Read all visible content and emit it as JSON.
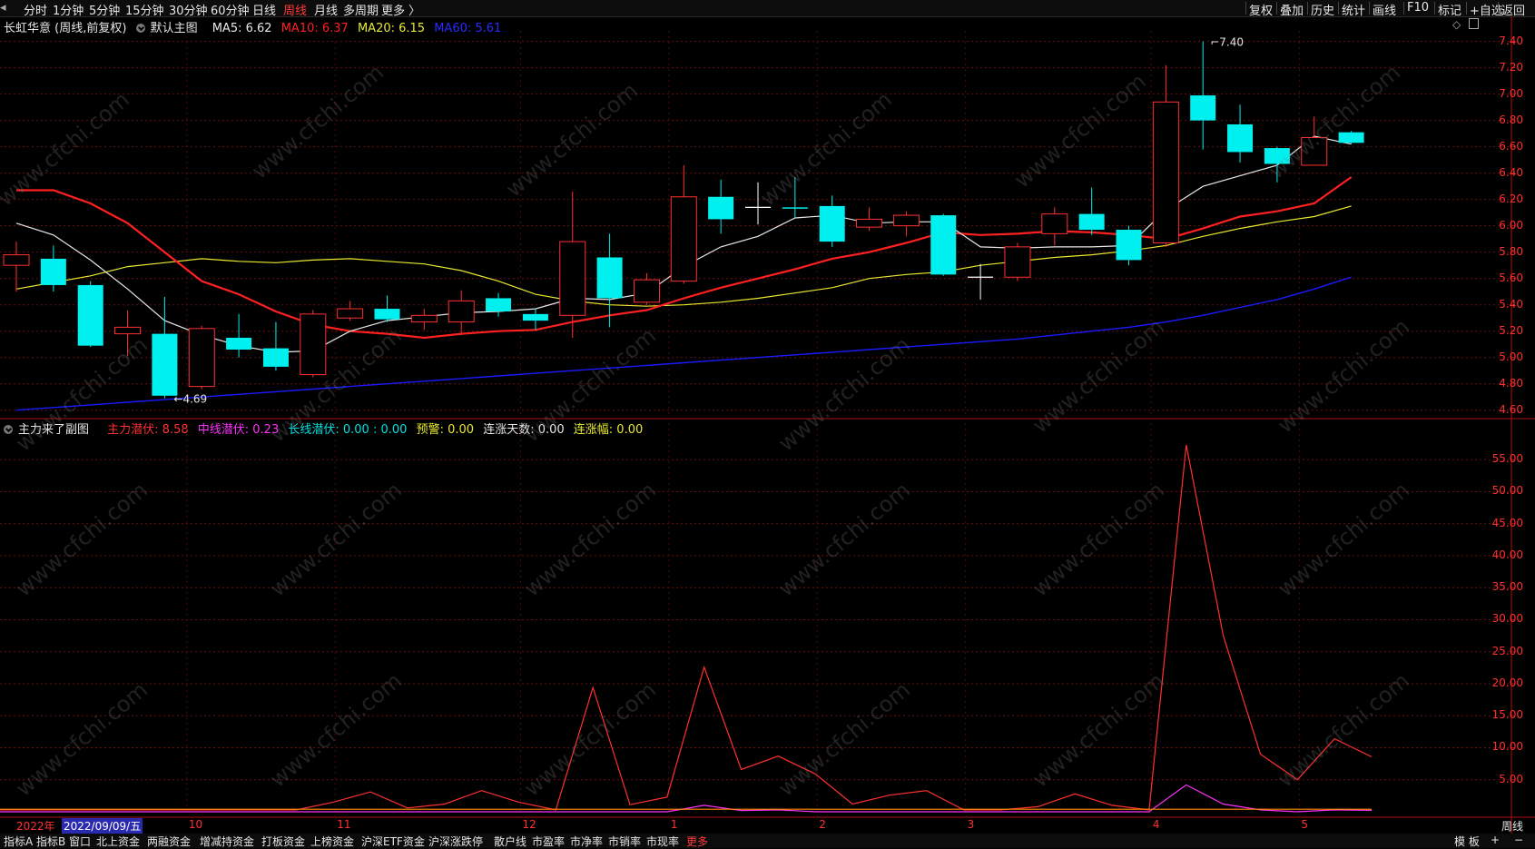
{
  "topbar": {
    "periods": [
      "分时",
      "1分钟",
      "5分钟",
      "15分钟",
      "30分钟",
      "60分钟",
      "日线",
      "周线",
      "月线",
      "多周期",
      "更多 〉"
    ],
    "active_index": 7,
    "right_tools": [
      "复权",
      "叠加",
      "历史",
      "统计",
      "画线",
      "F10",
      "标记",
      "+自选",
      "返回"
    ]
  },
  "main_legend": {
    "title": "长虹华意 (周线,前复权)",
    "indicator": "默认主图",
    "ma5": "MA5: 6.62",
    "ma10": "MA10: 6.37",
    "ma20": "MA20: 6.15",
    "ma60": "MA60: 5.61"
  },
  "sub_legend": {
    "title": "主力来了副图",
    "a": "主力潜伏: 8.58",
    "b": "中线潜伏: 0.23",
    "c": "长线潜伏: 0.00 : 0.00",
    "d": "预警: 0.00",
    "e": "连涨天数: 0.00",
    "f": "连涨幅: 0.00"
  },
  "colors": {
    "up": "#ff3030",
    "down": "#00f0f0",
    "ma5": "#e8e8e8",
    "ma10": "#ff2020",
    "ma20": "#e8e830",
    "ma60": "#1a1aff",
    "magenta": "#ff30ff"
  },
  "main_axis": [
    "7.40",
    "7.20",
    "7.00",
    "6.80",
    "6.60",
    "6.40",
    "6.20",
    "6.00",
    "5.80",
    "5.60",
    "5.40",
    "5.20",
    "5.00",
    "4.80",
    "4.60"
  ],
  "sub_axis": [
    "55.00",
    "50.00",
    "45.00",
    "40.00",
    "35.00",
    "30.00",
    "25.00",
    "20.00",
    "15.00",
    "10.00",
    "5.00"
  ],
  "annotations": {
    "high": "7.40",
    "low": "4.69"
  },
  "date_axis": {
    "year": "2022年",
    "current": "2022/09/09/五",
    "months": [
      "10",
      "11",
      "12",
      "1",
      "2",
      "3",
      "4",
      "5"
    ],
    "period_label": "周线"
  },
  "bottom_tabs": [
    "指标A",
    "指标B",
    "窗口",
    "北上资金",
    "两融资金",
    "增减持资金",
    "打板资金",
    "上榜资金",
    "沪深ETF资金",
    "沪深涨跌停",
    "散户线",
    "市盈率",
    "市净率",
    "市销率",
    "市现率",
    "更多"
  ],
  "bottom_right": [
    "模 板",
    "+",
    "−"
  ],
  "watermark": "www.cfchi.com",
  "chart_data": {
    "type": "candlestick",
    "candles": [
      {
        "o": 5.7,
        "c": 5.78,
        "h": 5.88,
        "l": 5.5
      },
      {
        "o": 5.75,
        "c": 5.55,
        "h": 5.85,
        "l": 5.5
      },
      {
        "o": 5.55,
        "c": 5.09,
        "h": 5.58,
        "l": 5.08
      },
      {
        "o": 5.18,
        "c": 5.23,
        "h": 5.36,
        "l": 5.01
      },
      {
        "o": 5.18,
        "c": 4.71,
        "h": 5.46,
        "l": 4.69
      },
      {
        "o": 4.78,
        "c": 5.22,
        "h": 5.24,
        "l": 4.76
      },
      {
        "o": 5.15,
        "c": 5.06,
        "h": 5.33,
        "l": 5.0
      },
      {
        "o": 5.07,
        "c": 4.93,
        "h": 5.27,
        "l": 4.9
      },
      {
        "o": 4.87,
        "c": 5.33,
        "h": 5.36,
        "l": 4.85
      },
      {
        "o": 5.3,
        "c": 5.37,
        "h": 5.43,
        "l": 5.28
      },
      {
        "o": 5.37,
        "c": 5.29,
        "h": 5.47,
        "l": 5.27
      },
      {
        "o": 5.27,
        "c": 5.32,
        "h": 5.37,
        "l": 5.21
      },
      {
        "o": 5.27,
        "c": 5.43,
        "h": 5.51,
        "l": 5.17
      },
      {
        "o": 5.45,
        "c": 5.35,
        "h": 5.49,
        "l": 5.31
      },
      {
        "o": 5.33,
        "c": 5.28,
        "h": 5.37,
        "l": 5.21
      },
      {
        "o": 5.32,
        "c": 5.88,
        "h": 6.26,
        "l": 5.15
      },
      {
        "o": 5.76,
        "c": 5.45,
        "h": 5.94,
        "l": 5.23
      },
      {
        "o": 5.42,
        "c": 5.59,
        "h": 5.64,
        "l": 5.4
      },
      {
        "o": 5.58,
        "c": 6.22,
        "h": 6.46,
        "l": 5.56
      },
      {
        "o": 6.22,
        "c": 6.05,
        "h": 6.35,
        "l": 5.94
      },
      {
        "o": 6.14,
        "c": 6.14,
        "h": 6.33,
        "l": 6.01
      },
      {
        "o": 6.14,
        "c": 6.13,
        "h": 6.37,
        "l": 6.06
      },
      {
        "o": 6.15,
        "c": 5.88,
        "h": 6.23,
        "l": 5.84
      },
      {
        "o": 5.99,
        "c": 6.05,
        "h": 6.14,
        "l": 5.96
      },
      {
        "o": 6.0,
        "c": 6.08,
        "h": 6.11,
        "l": 5.92
      },
      {
        "o": 6.08,
        "c": 5.63,
        "h": 6.09,
        "l": 5.62
      },
      {
        "o": 5.61,
        "c": 5.61,
        "h": 5.71,
        "l": 5.44
      },
      {
        "o": 5.61,
        "c": 5.84,
        "h": 5.87,
        "l": 5.58
      },
      {
        "o": 5.94,
        "c": 6.09,
        "h": 6.14,
        "l": 5.85
      },
      {
        "o": 6.09,
        "c": 5.97,
        "h": 6.29,
        "l": 5.93
      },
      {
        "o": 5.97,
        "c": 5.74,
        "h": 6.0,
        "l": 5.7
      },
      {
        "o": 5.87,
        "c": 6.94,
        "h": 7.22,
        "l": 5.84
      },
      {
        "o": 6.99,
        "c": 6.8,
        "h": 7.4,
        "l": 6.58
      },
      {
        "o": 6.77,
        "c": 6.56,
        "h": 6.92,
        "l": 6.48
      },
      {
        "o": 6.59,
        "c": 6.47,
        "h": 6.6,
        "l": 6.33
      },
      {
        "o": 6.46,
        "c": 6.67,
        "h": 6.83,
        "l": 6.46
      },
      {
        "o": 6.71,
        "c": 6.63,
        "h": 6.72,
        "l": 6.62
      }
    ],
    "ma5": [
      6.02,
      5.93,
      5.74,
      5.52,
      5.28,
      5.17,
      5.09,
      5.04,
      5.05,
      5.2,
      5.28,
      5.31,
      5.34,
      5.35,
      5.37,
      5.45,
      5.44,
      5.49,
      5.69,
      5.84,
      5.92,
      6.06,
      6.08,
      6.02,
      6.03,
      6.03,
      5.84,
      5.83,
      5.84,
      5.84,
      5.85,
      6.12,
      6.3,
      6.38,
      6.46,
      6.68,
      6.62
    ],
    "ma10": [
      6.27,
      6.27,
      6.17,
      6.02,
      5.8,
      5.58,
      5.48,
      5.35,
      5.25,
      5.2,
      5.18,
      5.15,
      5.18,
      5.2,
      5.21,
      5.27,
      5.32,
      5.36,
      5.45,
      5.53,
      5.6,
      5.67,
      5.75,
      5.8,
      5.87,
      5.95,
      5.93,
      5.94,
      5.96,
      5.95,
      5.93,
      5.9,
      5.98,
      6.07,
      6.11,
      6.17,
      6.37
    ],
    "ma20": [
      5.52,
      5.57,
      5.62,
      5.69,
      5.72,
      5.75,
      5.73,
      5.72,
      5.74,
      5.75,
      5.73,
      5.71,
      5.66,
      5.58,
      5.48,
      5.43,
      5.4,
      5.39,
      5.4,
      5.42,
      5.45,
      5.49,
      5.53,
      5.6,
      5.63,
      5.65,
      5.7,
      5.73,
      5.76,
      5.78,
      5.81,
      5.85,
      5.92,
      5.98,
      6.03,
      6.07,
      6.15
    ],
    "ma60": [
      4.6,
      4.62,
      4.64,
      4.66,
      4.68,
      4.7,
      4.72,
      4.74,
      4.76,
      4.78,
      4.8,
      4.82,
      4.84,
      4.86,
      4.88,
      4.9,
      4.92,
      4.94,
      4.96,
      4.98,
      5.0,
      5.02,
      5.04,
      5.06,
      5.08,
      5.1,
      5.12,
      5.14,
      5.17,
      5.2,
      5.23,
      5.27,
      5.32,
      5.38,
      5.44,
      5.52,
      5.61
    ],
    "sub_red": [
      0.3,
      0.3,
      0.3,
      0.3,
      0.3,
      0.3,
      0.3,
      0.3,
      0.3,
      1.5,
      3.1,
      0.6,
      1.2,
      3.3,
      1.5,
      0.3,
      19.4,
      1.1,
      2.3,
      22.6,
      6.6,
      8.7,
      5.9,
      1.2,
      2.6,
      3.3,
      0.3,
      0.3,
      0.8,
      2.8,
      1.0,
      0.3,
      57.3,
      27.5,
      9.0,
      5.0,
      11.4,
      8.58
    ],
    "sub_magenta": [
      0,
      0,
      0,
      0,
      0,
      0,
      0,
      0,
      0,
      0,
      0,
      0,
      0,
      0,
      0,
      0,
      0,
      0,
      0,
      1.0,
      0.2,
      0.3,
      0,
      0,
      0,
      0,
      0,
      0,
      0,
      0,
      0,
      0,
      4.2,
      1.2,
      0.3,
      0,
      0.3,
      0.23
    ],
    "main_ylim": [
      4.55,
      7.48
    ],
    "sub_ylim": [
      0,
      59
    ]
  }
}
